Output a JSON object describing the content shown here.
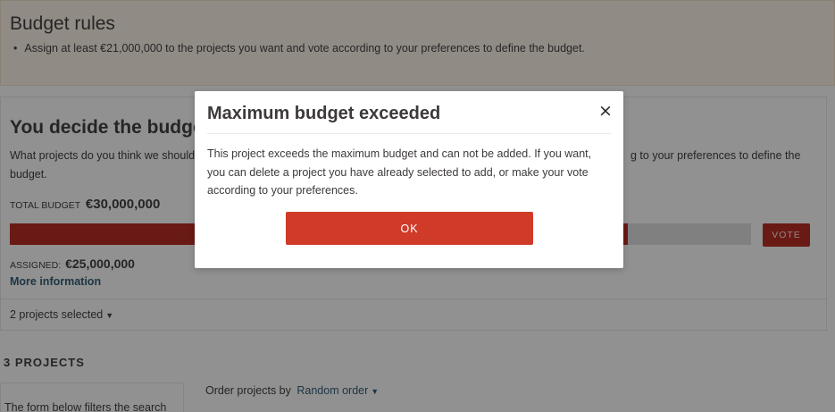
{
  "rules": {
    "title": "Budget rules",
    "items": [
      "Assign at least €21,000,000 to the projects you want and vote according to your preferences to define the budget."
    ]
  },
  "budget_card": {
    "title": "You decide the budget",
    "description_left": "What projects do you think we should a",
    "description_right": "g to your preferences to define the",
    "description_line2": "budget.",
    "total_label": "TOTAL BUDGET",
    "total_value": "€30,000,000",
    "progress_fraction": 0.8333,
    "vote_label": "VOTE",
    "assigned_label": "ASSIGNED:",
    "assigned_value": "€25,000,000",
    "more_info": "More information",
    "selected": "2 projects selected"
  },
  "projects": {
    "heading": "3 PROJECTS",
    "filter_text": "The form below filters the search",
    "order_label": "Order projects by",
    "order_value": "Random order"
  },
  "modal": {
    "title": "Maximum budget exceeded",
    "close_glyph": "×",
    "body": "This project exceeds the maximum budget and can not be added. If you want, you can delete a project you have already selected to add, or make your vote according to your preferences.",
    "ok_label": "OK"
  },
  "colors": {
    "accent_red": "#b8271d",
    "ok_red": "#cf3a29",
    "link_blue": "#2c5973",
    "rules_bg": "#fdf6ea"
  }
}
